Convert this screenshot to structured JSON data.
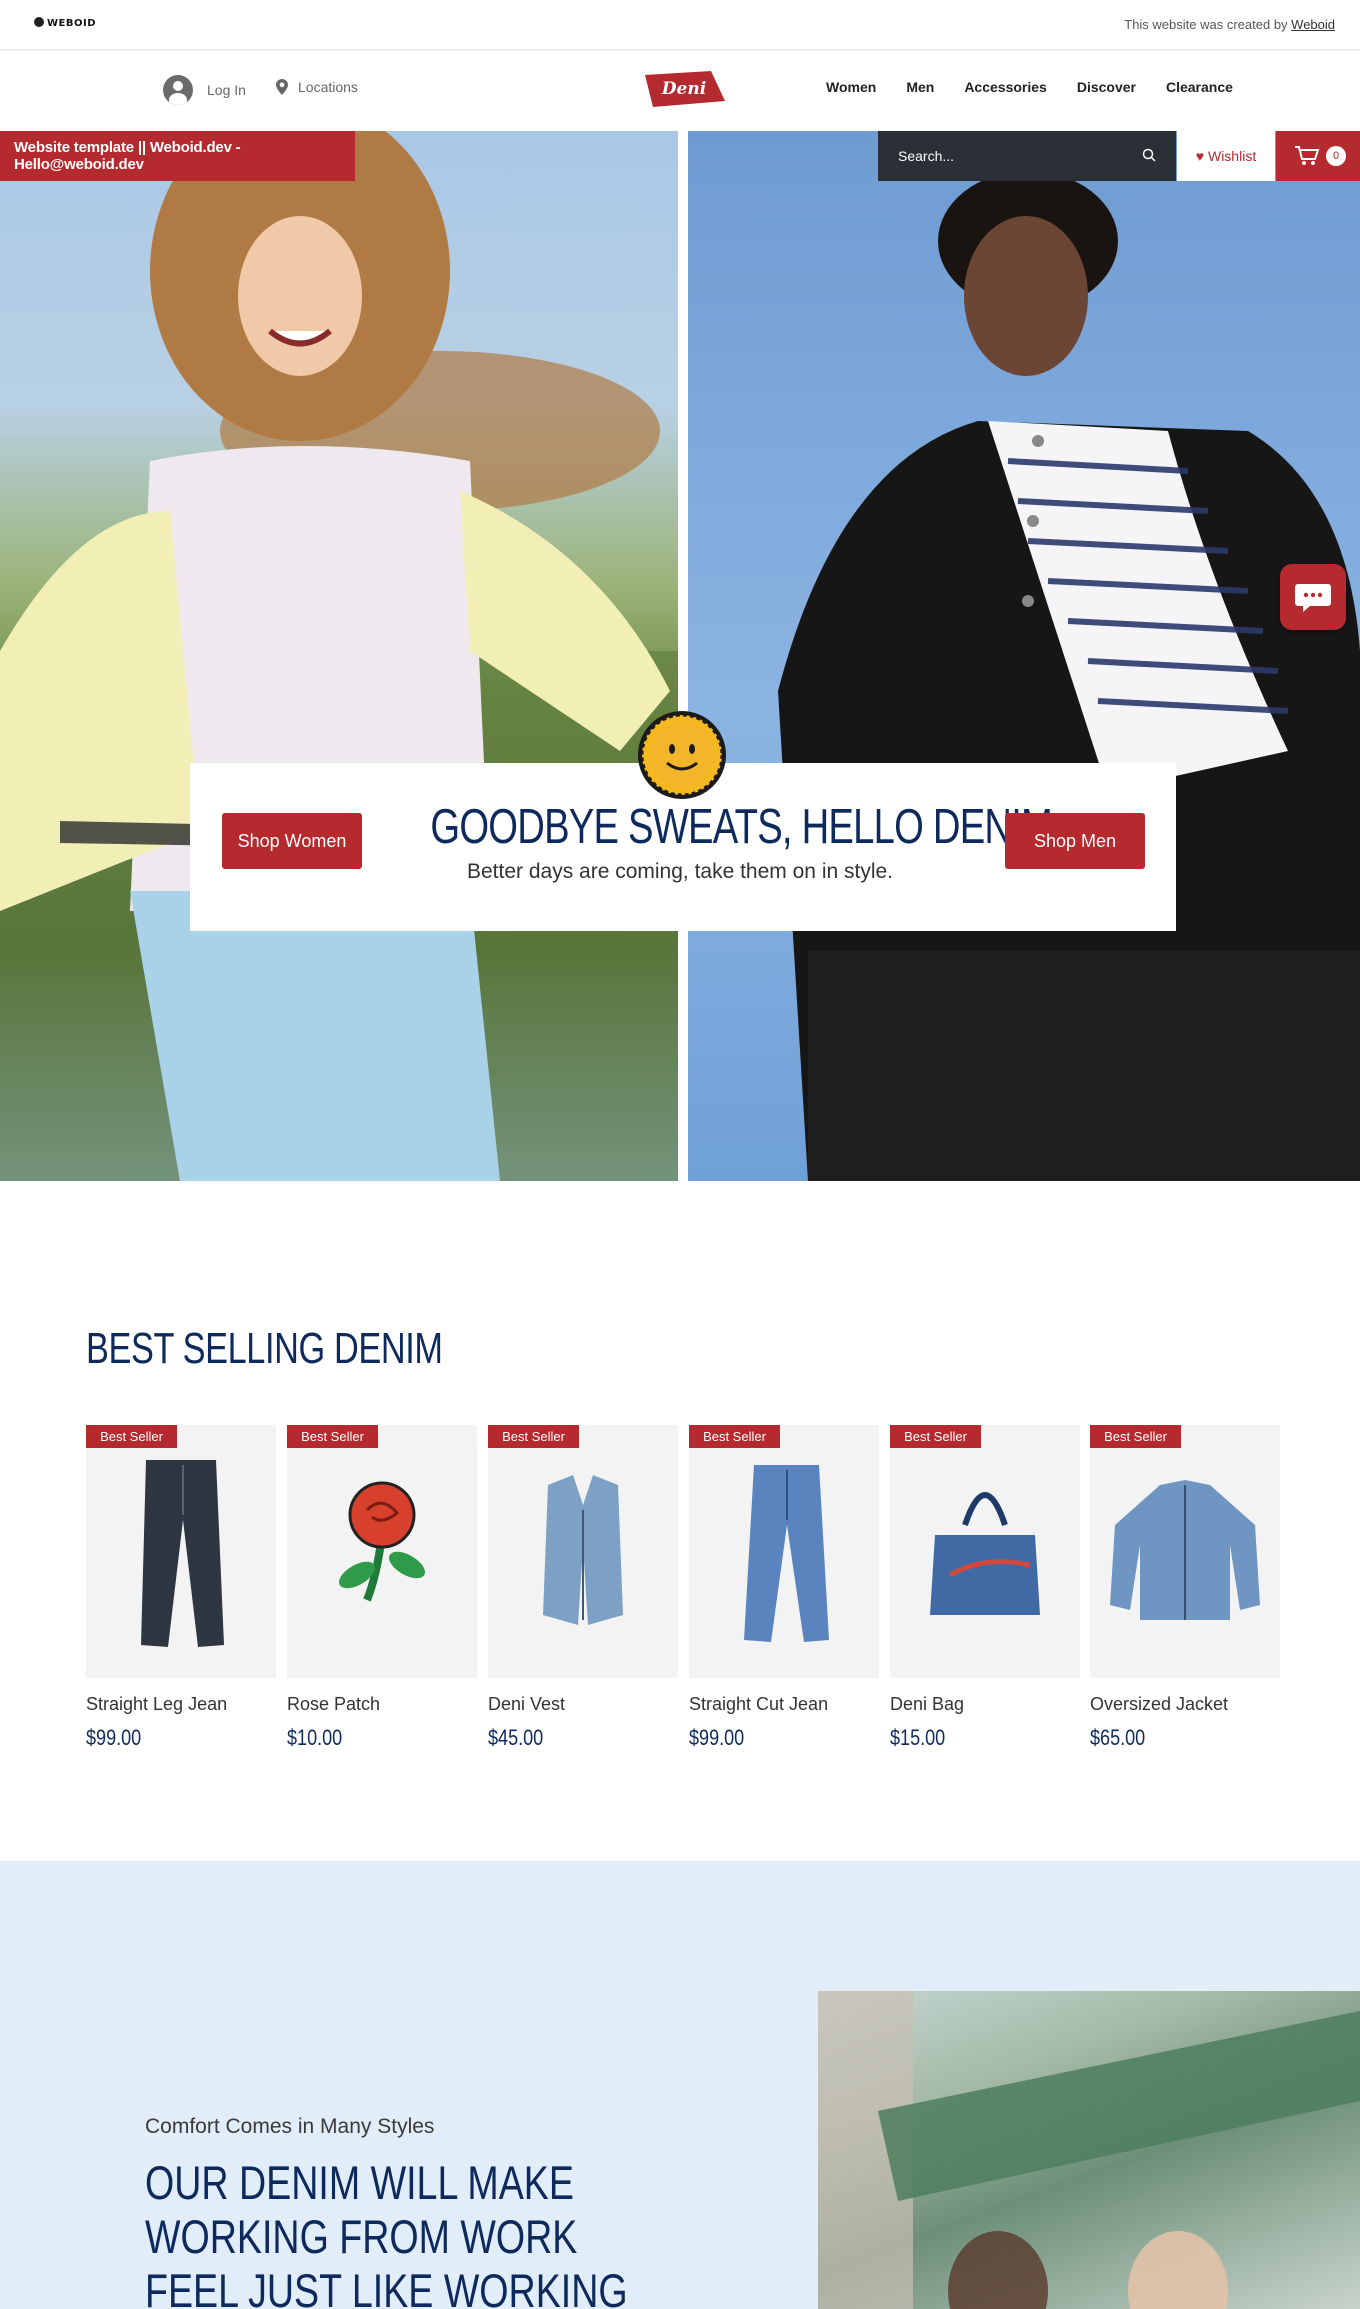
{
  "topbar": {
    "logo": "WEBOID",
    "credit_prefix": "This website was created by ",
    "credit_link": "Weboid"
  },
  "header": {
    "login_label": "Log In",
    "locations_label": "Locations",
    "brand": "Deni",
    "nav": [
      "Women",
      "Men",
      "Accessories",
      "Discover",
      "Clearance"
    ]
  },
  "hero": {
    "template_banner": "Website template || Weboid.dev - Hello@weboid.dev",
    "search_placeholder": "Search...",
    "wishlist_label": "♥ Wishlist",
    "cart_count": "0",
    "headline": "GOODBYE SWEATS, HELLO DENIM",
    "subline": "Better days are coming, take them on in style.",
    "shop_women": "Shop Women",
    "shop_men": "Shop Men"
  },
  "best_selling": {
    "title": "BEST SELLING DENIM",
    "tag": "Best Seller",
    "products": [
      {
        "name": "Straight Leg Jean",
        "price": "$99.00",
        "icon": "dark-jeans-icon"
      },
      {
        "name": "Rose Patch",
        "price": "$10.00",
        "icon": "rose-patch-icon"
      },
      {
        "name": "Deni Vest",
        "price": "$45.00",
        "icon": "denim-vest-icon"
      },
      {
        "name": "Straight Cut Jean",
        "price": "$99.00",
        "icon": "light-jeans-icon"
      },
      {
        "name": "Deni Bag",
        "price": "$15.00",
        "icon": "denim-bag-icon"
      },
      {
        "name": "Oversized Jacket",
        "price": "$65.00",
        "icon": "denim-jacket-icon"
      }
    ]
  },
  "lower": {
    "kicker": "Comfort Comes in Many Styles",
    "headline": "OUR DENIM WILL MAKE WORKING FROM WORK FEEL JUST LIKE WORKING FROM HOME"
  },
  "colors": {
    "brand_red": "#b52a2f",
    "navy": "#0e2a5c",
    "search_bg": "#2b2f36",
    "lower_bg": "#e1edf9"
  }
}
